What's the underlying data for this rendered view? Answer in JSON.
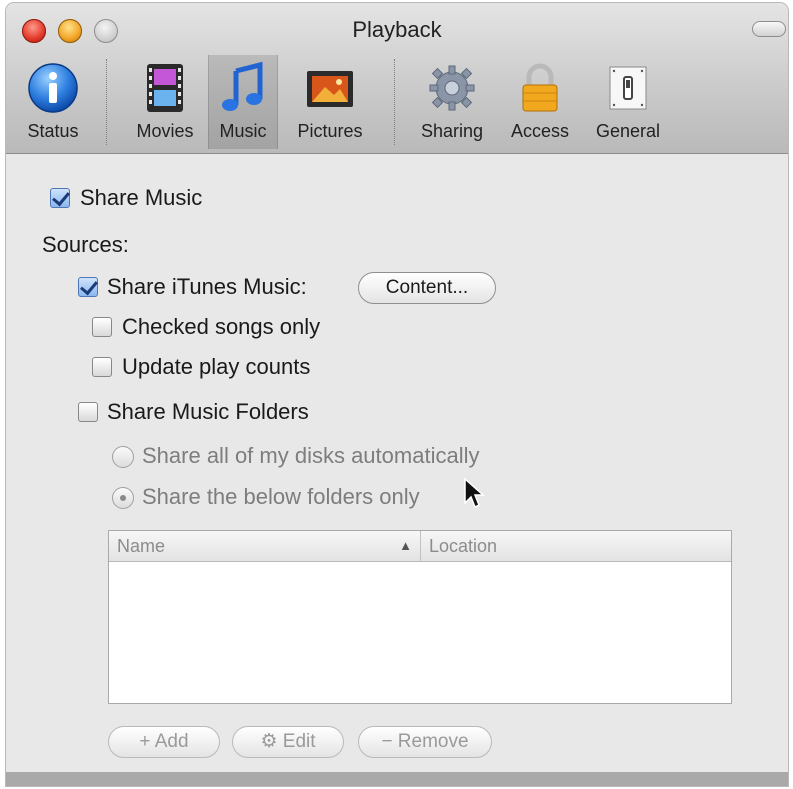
{
  "window": {
    "title": "Playback"
  },
  "toolbar": {
    "items": [
      {
        "label": "Status",
        "icon": "info-icon"
      },
      {
        "label": "Movies",
        "icon": "film-icon"
      },
      {
        "label": "Music",
        "icon": "music-note-icon",
        "selected": true
      },
      {
        "label": "Pictures",
        "icon": "picture-icon"
      },
      {
        "label": "Sharing",
        "icon": "gear-icon"
      },
      {
        "label": "Access",
        "icon": "padlock-icon"
      },
      {
        "label": "General",
        "icon": "switch-icon"
      }
    ]
  },
  "music": {
    "share_music": {
      "label": "Share Music",
      "checked": true
    },
    "sources_label": "Sources:",
    "share_itunes": {
      "label": "Share iTunes Music:",
      "checked": true
    },
    "content_button": "Content...",
    "checked_songs_only": {
      "label": "Checked songs only",
      "checked": false
    },
    "update_play_counts": {
      "label": "Update play counts",
      "checked": false
    },
    "share_folders": {
      "label": "Share Music Folders",
      "checked": false
    },
    "radio_all_disks": {
      "label": "Share all of my disks automatically",
      "selected": false
    },
    "radio_below_folders": {
      "label": "Share the below folders only",
      "selected": true
    },
    "table": {
      "columns": [
        "Name",
        "Location"
      ],
      "sort_indicator": "▲",
      "rows": []
    },
    "buttons": {
      "add": "+ Add",
      "edit": "⚙ Edit",
      "remove": "− Remove"
    }
  },
  "colors": {
    "selected_check": "#8bb7ef",
    "disabled_text": "#9a9a9a"
  }
}
